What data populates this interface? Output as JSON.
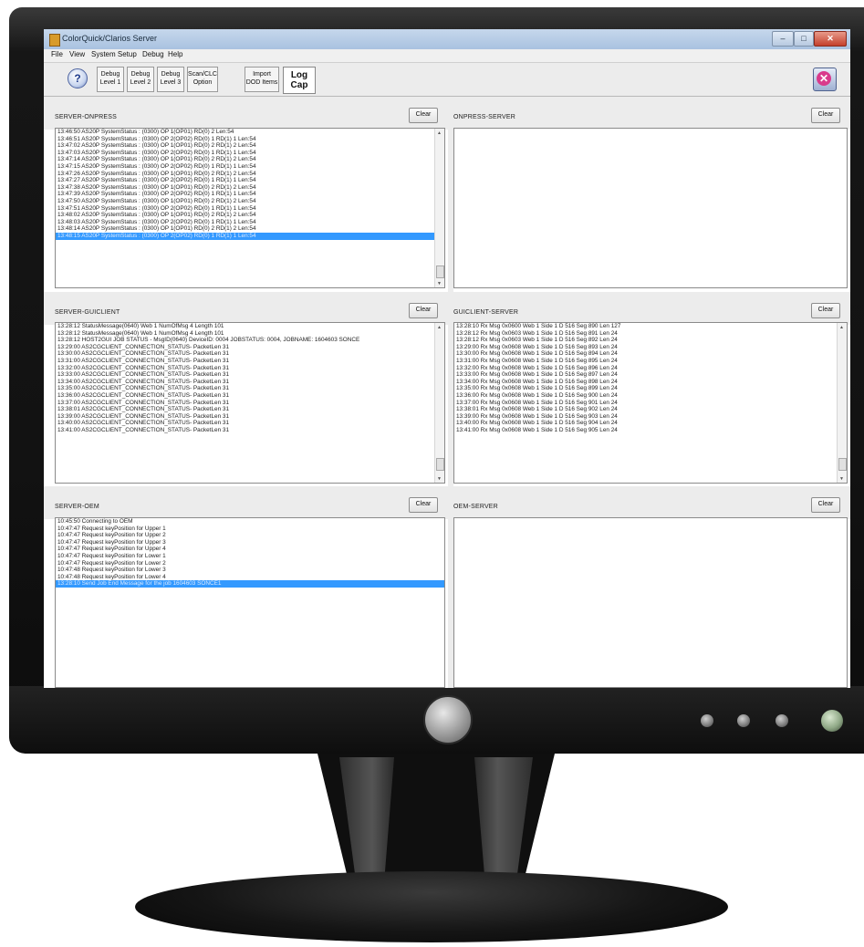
{
  "window": {
    "title": "ColorQuick/Clarios Server",
    "controls": {
      "minimize": "–",
      "maximize": "□",
      "close": "✕"
    }
  },
  "menu": [
    "File",
    "View",
    "System Setup",
    "Debug",
    "Help"
  ],
  "toolbar": {
    "help_icon": "question-icon",
    "help_glyph": "?",
    "buttons": [
      {
        "line1": "Debug",
        "line2": "Level 1"
      },
      {
        "line1": "Debug",
        "line2": "Level 2"
      },
      {
        "line1": "Debug",
        "line2": "Level 3"
      },
      {
        "line1": "Scan/CLC",
        "line2": "Option"
      },
      {
        "line1": "Import",
        "line2": "DOD Items"
      }
    ],
    "logcap": {
      "line1": "Log",
      "line2": "Cap"
    },
    "exit_glyph": "✕",
    "exit_icon": "exit-icon"
  },
  "panels": {
    "server_onpress": {
      "label": "SERVER-ONPRESS",
      "clear": "Clear",
      "lines": [
        "13:46:50 AS20P SystemStatus : (0300) OP 1(OP01) RD(0) 2 Len:54",
        "13:46:51 AS20P SystemStatus : (0300) OP 2(OP02) RD(0) 1 RD(1) 1 Len:54",
        "13:47:02 AS20P SystemStatus : (0300) OP 1(OP01) RD(0) 2 RD(1) 2 Len:54",
        "13:47:03 AS20P SystemStatus : (0300) OP 2(OP02) RD(0) 1 RD(1) 1 Len:54",
        "13:47:14 AS20P SystemStatus : (0300) OP 1(OP01) RD(0) 2 RD(1) 2 Len:54",
        "13:47:15 AS20P SystemStatus : (0300) OP 2(OP02) RD(0) 1 RD(1) 1 Len:54",
        "13:47:26 AS20P SystemStatus : (0300) OP 1(OP01) RD(0) 2 RD(1) 2 Len:54",
        "13:47:27 AS20P SystemStatus : (0300) OP 2(OP02) RD(0) 1 RD(1) 1 Len:54",
        "13:47:38 AS20P SystemStatus : (0300) OP 1(OP01) RD(0) 2 RD(1) 2 Len:54",
        "13:47:39 AS20P SystemStatus : (0300) OP 2(OP02) RD(0) 1 RD(1) 1 Len:54",
        "13:47:50 AS20P SystemStatus : (0300) OP 1(OP01) RD(0) 2 RD(1) 2 Len:54",
        "13:47:51 AS20P SystemStatus : (0300) OP 2(OP02) RD(0) 1 RD(1) 1 Len:54",
        "13:48:02 AS20P SystemStatus : (0300) OP 1(OP01) RD(0) 2 RD(1) 2 Len:54",
        "13:48:03 AS20P SystemStatus : (0300) OP 2(OP02) RD(0) 1 RD(1) 1 Len:54",
        "13:48:14 AS20P SystemStatus : (0300) OP 1(OP01) RD(0) 2 RD(1) 2 Len:54",
        "13:48:15 AS20P SystemStatus : (0300) OP 2(OP02) RD(0) 1 RD(1) 1 Len:54"
      ],
      "selected_index": 15
    },
    "onpress_server": {
      "label": "ONPRESS-SERVER",
      "clear": "Clear",
      "lines": []
    },
    "server_guiclient": {
      "label": "SERVER-GUICLIENT",
      "clear": "Clear",
      "lines": [
        "13:28:12 StatusMessage(0640) Web 1 NumOfMsg 4 Length 101",
        "13:28:12 StatusMessage(0640) Web 1 NumOfMsg 4 Length 101",
        "13:28:12 HOST2GUI JOB STATUS - MsgID(0640) DeviceID: 0004 JOBSTATUS: 0004, JOBNAME: 1604603 SONCE",
        "13:29:00 AS2CGCLIENT_CONNECTION_STATUS- PacketLen 31",
        "13:30:00 AS2CGCLIENT_CONNECTION_STATUS- PacketLen 31",
        "13:31:00 AS2CGCLIENT_CONNECTION_STATUS- PacketLen 31",
        "13:32:00 AS2CGCLIENT_CONNECTION_STATUS- PacketLen 31",
        "13:33:00 AS2CGCLIENT_CONNECTION_STATUS- PacketLen 31",
        "13:34:00 AS2CGCLIENT_CONNECTION_STATUS- PacketLen 31",
        "13:35:00 AS2CGCLIENT_CONNECTION_STATUS- PacketLen 31",
        "13:36:00 AS2CGCLIENT_CONNECTION_STATUS- PacketLen 31",
        "13:37:00 AS2CGCLIENT_CONNECTION_STATUS- PacketLen 31",
        "13:38:01 AS2CGCLIENT_CONNECTION_STATUS- PacketLen 31",
        "13:39:00 AS2CGCLIENT_CONNECTION_STATUS- PacketLen 31",
        "13:40:00 AS2CGCLIENT_CONNECTION_STATUS- PacketLen 31",
        "13:41:00 AS2CGCLIENT_CONNECTION_STATUS- PacketLen 31"
      ]
    },
    "guiclient_server": {
      "label": "GUICLIENT-SERVER",
      "clear": "Clear",
      "lines": [
        "13:28:10 Rx Msg 0x0600 Web 1 Side 1 D 516 Seg 890 Len 127",
        "13:28:12 Rx Msg 0x0603 Web 1 Side 1 D 516 Seg 891 Len 24",
        "13:28:12 Rx Msg 0x0603 Web 1 Side 1 D 516 Seg 892 Len 24",
        "13:29:00 Rx Msg 0x0608 Web 1 Side 1 D 516 Seg 893 Len 24",
        "13:30:00 Rx Msg 0x0608 Web 1 Side 1 D 516 Seg 894 Len 24",
        "13:31:00 Rx Msg 0x0608 Web 1 Side 1 D 516 Seg 895 Len 24",
        "13:32:00 Rx Msg 0x0608 Web 1 Side 1 D 516 Seg 896 Len 24",
        "13:33:00 Rx Msg 0x0608 Web 1 Side 1 D 516 Seg 897 Len 24",
        "13:34:00 Rx Msg 0x0608 Web 1 Side 1 D 516 Seg 898 Len 24",
        "13:35:00 Rx Msg 0x0608 Web 1 Side 1 D 516 Seg 899 Len 24",
        "13:36:00 Rx Msg 0x0608 Web 1 Side 1 D 516 Seg 900 Len 24",
        "13:37:00 Rx Msg 0x0608 Web 1 Side 1 D 516 Seg 901 Len 24",
        "13:38:01 Rx Msg 0x0608 Web 1 Side 1 D 516 Seg 902 Len 24",
        "13:39:00 Rx Msg 0x0608 Web 1 Side 1 D 516 Seg 903 Len 24",
        "13:40:00 Rx Msg 0x0608 Web 1 Side 1 D 516 Seg 904 Len 24",
        "13:41:00 Rx Msg 0x0608 Web 1 Side 1 D 516 Seg 905 Len 24"
      ]
    },
    "server_oem": {
      "label": "SERVER-OEM",
      "clear": "Clear",
      "lines": [
        "10:45:50 Connecting to OEM",
        "10:47:47 Request keyPosition for Upper 1",
        "10:47:47 Request keyPosition for Upper 2",
        "10:47:47 Request keyPosition for Upper 3",
        "10:47:47 Request keyPosition for Upper 4",
        "10:47:47 Request keyPosition for Lower 1",
        "10:47:47 Request keyPosition for Lower 2",
        "10:47:48 Request keyPosition for Lower 3",
        "10:47:48 Request keyPosition for Lower 4",
        "13:28:10 Send Job End Message for the job 1604603 SONCE1"
      ],
      "selected_index": 9
    },
    "oem_server": {
      "label": "OEM-SERVER",
      "clear": "Clear",
      "lines": []
    }
  },
  "colors": {
    "selection": "#3399ff",
    "titlebar": "#a9c2e0"
  }
}
